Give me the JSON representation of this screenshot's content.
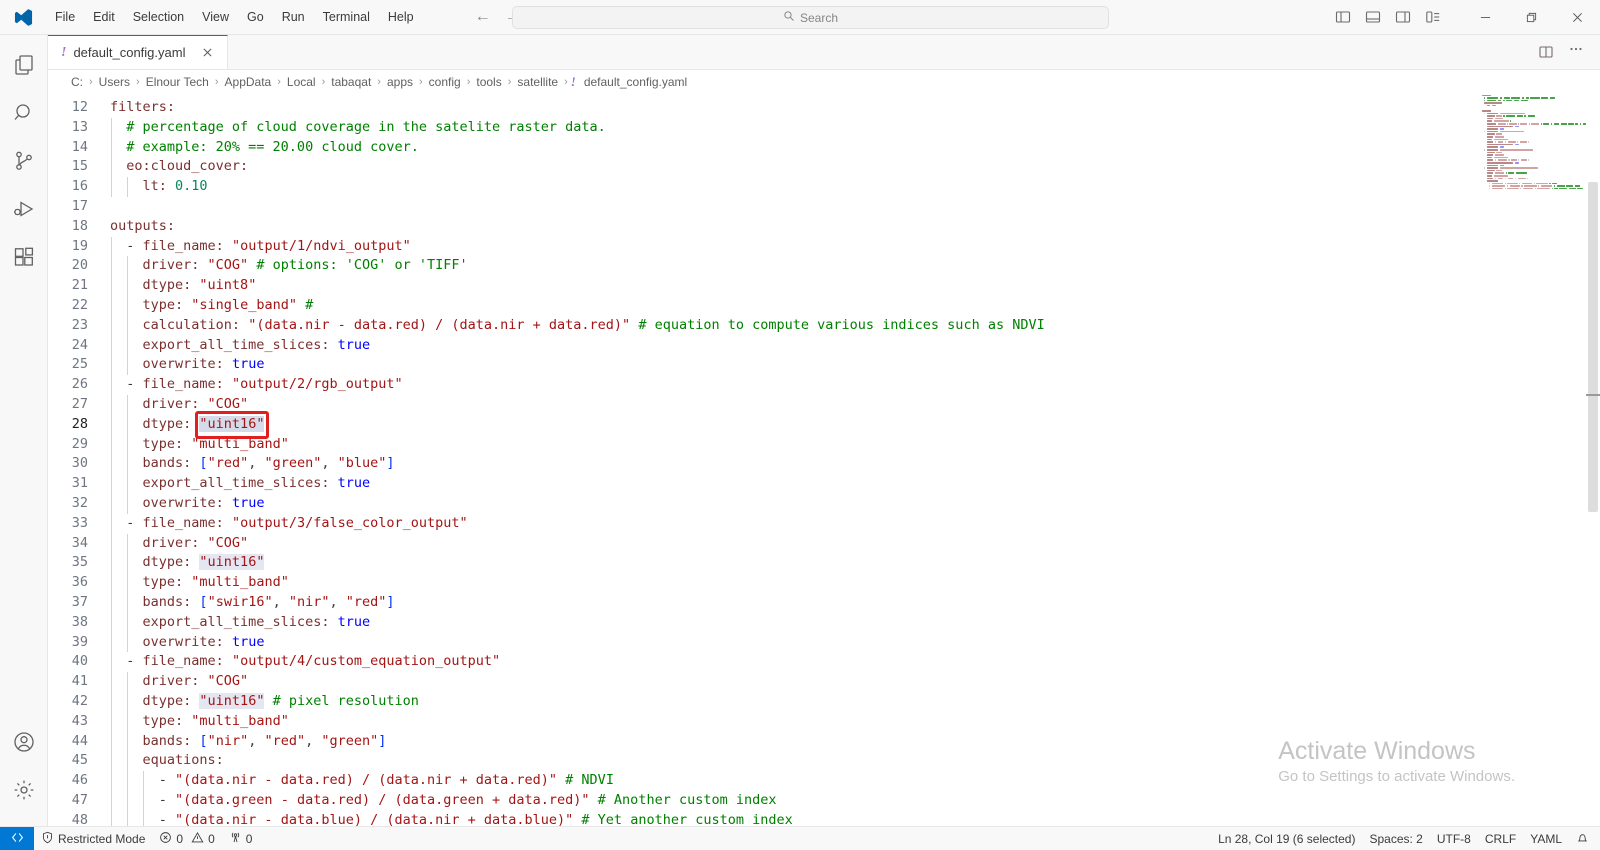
{
  "titlebar": {
    "logo_icon": "vscode-logo",
    "menus": [
      "File",
      "Edit",
      "Selection",
      "View",
      "Go",
      "Run",
      "Terminal",
      "Help"
    ],
    "nav_back_icon": "arrow-left-icon",
    "nav_forward_icon": "arrow-right-icon",
    "search": {
      "placeholder": "Search",
      "value": "",
      "icon": "search-icon"
    },
    "layout_buttons": [
      {
        "name": "toggle-primary-sidebar",
        "icon": "layout-sidebar-left-icon"
      },
      {
        "name": "toggle-panel",
        "icon": "layout-panel-icon"
      },
      {
        "name": "toggle-secondary-sidebar",
        "icon": "layout-sidebar-right-icon"
      },
      {
        "name": "customize-layout",
        "icon": "layout-customize-icon"
      }
    ],
    "window_controls": [
      {
        "name": "minimize",
        "icon": "minimize-icon"
      },
      {
        "name": "maximize",
        "icon": "restore-icon"
      },
      {
        "name": "close",
        "icon": "close-icon"
      }
    ]
  },
  "activitybar": {
    "top": [
      {
        "name": "explorer",
        "icon": "files-icon"
      },
      {
        "name": "search",
        "icon": "search-icon"
      },
      {
        "name": "source-control",
        "icon": "source-control-icon"
      },
      {
        "name": "run-and-debug",
        "icon": "run-debug-icon"
      },
      {
        "name": "extensions",
        "icon": "extensions-icon"
      }
    ],
    "bottom": [
      {
        "name": "accounts",
        "icon": "account-icon"
      },
      {
        "name": "manage",
        "icon": "gear-icon"
      }
    ]
  },
  "tabs": [
    {
      "label": "default_config.yaml",
      "icon": "yaml-file-icon",
      "close_icon": "close-icon",
      "active": true
    }
  ],
  "tabbar_actions": [
    {
      "name": "split-editor-right",
      "icon": "split-editor-icon"
    },
    {
      "name": "more-actions",
      "icon": "ellipsis-icon"
    }
  ],
  "breadcrumbs": {
    "separator": "›",
    "items": [
      "C:",
      "Users",
      "Elnour Tech",
      "AppData",
      "Local",
      "tabaqat",
      "apps",
      "config",
      "tools",
      "satellite"
    ],
    "file": {
      "label": "default_config.yaml",
      "icon": "yaml-file-icon"
    }
  },
  "editor": {
    "first_line_number": 12,
    "active_line": 28,
    "annotation": {
      "label": "highlight-box",
      "color": "#e02020",
      "target_text": "\"uint16\"",
      "line": 28
    },
    "lines": [
      {
        "n": 12,
        "indent_guides": 0,
        "tokens": [
          {
            "t": "filters:",
            "c": "t-key"
          }
        ]
      },
      {
        "n": 13,
        "indent_guides": 1,
        "tokens": [
          {
            "t": "  # percentage of cloud coverage in the satelite raster data.",
            "c": "t-cmt"
          }
        ]
      },
      {
        "n": 14,
        "indent_guides": 1,
        "tokens": [
          {
            "t": "  # example: 20% == 20.00 cloud cover.",
            "c": "t-cmt"
          }
        ]
      },
      {
        "n": 15,
        "indent_guides": 1,
        "tokens": [
          {
            "t": "  eo:cloud_cover:",
            "c": "t-key"
          }
        ]
      },
      {
        "n": 16,
        "indent_guides": 2,
        "tokens": [
          {
            "t": "    lt:",
            "c": "t-key"
          },
          {
            "t": " ",
            "c": "t-punct"
          },
          {
            "t": "0.10",
            "c": "t-num"
          }
        ]
      },
      {
        "n": 17,
        "indent_guides": 0,
        "tokens": []
      },
      {
        "n": 18,
        "indent_guides": 0,
        "tokens": [
          {
            "t": "outputs:",
            "c": "t-key"
          }
        ]
      },
      {
        "n": 19,
        "indent_guides": 1,
        "tokens": [
          {
            "t": "  - ",
            "c": "t-dash"
          },
          {
            "t": "file_name:",
            "c": "t-key"
          },
          {
            "t": " ",
            "c": "t-punct"
          },
          {
            "t": "\"output/1/ndvi_output\"",
            "c": "t-str"
          }
        ]
      },
      {
        "n": 20,
        "indent_guides": 2,
        "tokens": [
          {
            "t": "    driver:",
            "c": "t-key"
          },
          {
            "t": " ",
            "c": "t-punct"
          },
          {
            "t": "\"COG\"",
            "c": "t-str"
          },
          {
            "t": " # options: 'COG' or 'TIFF'",
            "c": "t-cmt"
          }
        ]
      },
      {
        "n": 21,
        "indent_guides": 2,
        "tokens": [
          {
            "t": "    dtype:",
            "c": "t-key"
          },
          {
            "t": " ",
            "c": "t-punct"
          },
          {
            "t": "\"uint8\"",
            "c": "t-str"
          }
        ]
      },
      {
        "n": 22,
        "indent_guides": 2,
        "tokens": [
          {
            "t": "    type:",
            "c": "t-key"
          },
          {
            "t": " ",
            "c": "t-punct"
          },
          {
            "t": "\"single_band\"",
            "c": "t-str"
          },
          {
            "t": " #",
            "c": "t-cmt"
          }
        ]
      },
      {
        "n": 23,
        "indent_guides": 2,
        "tokens": [
          {
            "t": "    calculation:",
            "c": "t-key"
          },
          {
            "t": " ",
            "c": "t-punct"
          },
          {
            "t": "\"(data.nir - data.red) / (data.nir + data.red)\"",
            "c": "t-str"
          },
          {
            "t": " # equation to compute various indices such as NDVI",
            "c": "t-cmt"
          }
        ]
      },
      {
        "n": 24,
        "indent_guides": 2,
        "tokens": [
          {
            "t": "    export_all_time_slices:",
            "c": "t-key"
          },
          {
            "t": " ",
            "c": "t-punct"
          },
          {
            "t": "true",
            "c": "t-bool"
          }
        ]
      },
      {
        "n": 25,
        "indent_guides": 2,
        "tokens": [
          {
            "t": "    overwrite:",
            "c": "t-key"
          },
          {
            "t": " ",
            "c": "t-punct"
          },
          {
            "t": "true",
            "c": "t-bool"
          }
        ]
      },
      {
        "n": 26,
        "indent_guides": 1,
        "tokens": [
          {
            "t": "  - ",
            "c": "t-dash"
          },
          {
            "t": "file_name:",
            "c": "t-key"
          },
          {
            "t": " ",
            "c": "t-punct"
          },
          {
            "t": "\"output/2/rgb_output\"",
            "c": "t-str"
          }
        ]
      },
      {
        "n": 27,
        "indent_guides": 2,
        "tokens": [
          {
            "t": "    driver:",
            "c": "t-key"
          },
          {
            "t": " ",
            "c": "t-punct"
          },
          {
            "t": "\"COG\"",
            "c": "t-str"
          }
        ]
      },
      {
        "n": 28,
        "indent_guides": 2,
        "tokens": [
          {
            "t": "    dtype:",
            "c": "t-key"
          },
          {
            "t": " ",
            "c": "t-punct"
          },
          {
            "t": "\"uint16\"",
            "c": "t-str sel-strong"
          }
        ]
      },
      {
        "n": 29,
        "indent_guides": 2,
        "tokens": [
          {
            "t": "    type:",
            "c": "t-key"
          },
          {
            "t": " ",
            "c": "t-punct"
          },
          {
            "t": "\"multi_band\"",
            "c": "t-str"
          }
        ]
      },
      {
        "n": 30,
        "indent_guides": 2,
        "tokens": [
          {
            "t": "    bands:",
            "c": "t-key"
          },
          {
            "t": " ",
            "c": "t-punct"
          },
          {
            "t": "[",
            "c": "t-brk"
          },
          {
            "t": "\"red\"",
            "c": "t-str"
          },
          {
            "t": ", ",
            "c": "t-punct"
          },
          {
            "t": "\"green\"",
            "c": "t-str"
          },
          {
            "t": ", ",
            "c": "t-punct"
          },
          {
            "t": "\"blue\"",
            "c": "t-str"
          },
          {
            "t": "]",
            "c": "t-brk"
          }
        ]
      },
      {
        "n": 31,
        "indent_guides": 2,
        "tokens": [
          {
            "t": "    export_all_time_slices:",
            "c": "t-key"
          },
          {
            "t": " ",
            "c": "t-punct"
          },
          {
            "t": "true",
            "c": "t-bool"
          }
        ]
      },
      {
        "n": 32,
        "indent_guides": 2,
        "tokens": [
          {
            "t": "    overwrite:",
            "c": "t-key"
          },
          {
            "t": " ",
            "c": "t-punct"
          },
          {
            "t": "true",
            "c": "t-bool"
          }
        ]
      },
      {
        "n": 33,
        "indent_guides": 1,
        "tokens": [
          {
            "t": "  - ",
            "c": "t-dash"
          },
          {
            "t": "file_name:",
            "c": "t-key"
          },
          {
            "t": " ",
            "c": "t-punct"
          },
          {
            "t": "\"output/3/false_color_output\"",
            "c": "t-str"
          }
        ]
      },
      {
        "n": 34,
        "indent_guides": 2,
        "tokens": [
          {
            "t": "    driver:",
            "c": "t-key"
          },
          {
            "t": " ",
            "c": "t-punct"
          },
          {
            "t": "\"COG\"",
            "c": "t-str"
          }
        ]
      },
      {
        "n": 35,
        "indent_guides": 2,
        "tokens": [
          {
            "t": "    dtype:",
            "c": "t-key"
          },
          {
            "t": " ",
            "c": "t-punct"
          },
          {
            "t": "\"uint16\"",
            "c": "t-str sel-hl"
          }
        ]
      },
      {
        "n": 36,
        "indent_guides": 2,
        "tokens": [
          {
            "t": "    type:",
            "c": "t-key"
          },
          {
            "t": " ",
            "c": "t-punct"
          },
          {
            "t": "\"multi_band\"",
            "c": "t-str"
          }
        ]
      },
      {
        "n": 37,
        "indent_guides": 2,
        "tokens": [
          {
            "t": "    bands:",
            "c": "t-key"
          },
          {
            "t": " ",
            "c": "t-punct"
          },
          {
            "t": "[",
            "c": "t-brk"
          },
          {
            "t": "\"swir16\"",
            "c": "t-str"
          },
          {
            "t": ", ",
            "c": "t-punct"
          },
          {
            "t": "\"nir\"",
            "c": "t-str"
          },
          {
            "t": ", ",
            "c": "t-punct"
          },
          {
            "t": "\"red\"",
            "c": "t-str"
          },
          {
            "t": "]",
            "c": "t-brk"
          }
        ]
      },
      {
        "n": 38,
        "indent_guides": 2,
        "tokens": [
          {
            "t": "    export_all_time_slices:",
            "c": "t-key"
          },
          {
            "t": " ",
            "c": "t-punct"
          },
          {
            "t": "true",
            "c": "t-bool"
          }
        ]
      },
      {
        "n": 39,
        "indent_guides": 2,
        "tokens": [
          {
            "t": "    overwrite:",
            "c": "t-key"
          },
          {
            "t": " ",
            "c": "t-punct"
          },
          {
            "t": "true",
            "c": "t-bool"
          }
        ]
      },
      {
        "n": 40,
        "indent_guides": 1,
        "tokens": [
          {
            "t": "  - ",
            "c": "t-dash"
          },
          {
            "t": "file_name:",
            "c": "t-key"
          },
          {
            "t": " ",
            "c": "t-punct"
          },
          {
            "t": "\"output/4/custom_equation_output\"",
            "c": "t-str"
          }
        ]
      },
      {
        "n": 41,
        "indent_guides": 2,
        "tokens": [
          {
            "t": "    driver:",
            "c": "t-key"
          },
          {
            "t": " ",
            "c": "t-punct"
          },
          {
            "t": "\"COG\"",
            "c": "t-str"
          }
        ]
      },
      {
        "n": 42,
        "indent_guides": 2,
        "tokens": [
          {
            "t": "    dtype:",
            "c": "t-key"
          },
          {
            "t": " ",
            "c": "t-punct"
          },
          {
            "t": "\"uint16\"",
            "c": "t-str sel-hl"
          },
          {
            "t": " # pixel resolution",
            "c": "t-cmt"
          }
        ]
      },
      {
        "n": 43,
        "indent_guides": 2,
        "tokens": [
          {
            "t": "    type:",
            "c": "t-key"
          },
          {
            "t": " ",
            "c": "t-punct"
          },
          {
            "t": "\"multi_band\"",
            "c": "t-str"
          }
        ]
      },
      {
        "n": 44,
        "indent_guides": 2,
        "tokens": [
          {
            "t": "    bands:",
            "c": "t-key"
          },
          {
            "t": " ",
            "c": "t-punct"
          },
          {
            "t": "[",
            "c": "t-brk"
          },
          {
            "t": "\"nir\"",
            "c": "t-str"
          },
          {
            "t": ", ",
            "c": "t-punct"
          },
          {
            "t": "\"red\"",
            "c": "t-str"
          },
          {
            "t": ", ",
            "c": "t-punct"
          },
          {
            "t": "\"green\"",
            "c": "t-str"
          },
          {
            "t": "]",
            "c": "t-brk"
          }
        ]
      },
      {
        "n": 45,
        "indent_guides": 2,
        "tokens": [
          {
            "t": "    equations:",
            "c": "t-key"
          }
        ]
      },
      {
        "n": 46,
        "indent_guides": 3,
        "tokens": [
          {
            "t": "      - ",
            "c": "t-dash"
          },
          {
            "t": "\"(data.nir - data.red) / (data.nir + data.red)\"",
            "c": "t-str"
          },
          {
            "t": " # NDVI",
            "c": "t-cmt"
          }
        ]
      },
      {
        "n": 47,
        "indent_guides": 3,
        "tokens": [
          {
            "t": "      - ",
            "c": "t-dash"
          },
          {
            "t": "\"(data.green - data.red) / (data.green + data.red)\"",
            "c": "t-str"
          },
          {
            "t": " # Another custom index",
            "c": "t-cmt"
          }
        ]
      },
      {
        "n": 48,
        "indent_guides": 3,
        "tokens": [
          {
            "t": "      - ",
            "c": "t-dash"
          },
          {
            "t": "\"(data.nir - data.blue) / (data.nir + data.blue)\"",
            "c": "t-str"
          },
          {
            "t": " # Yet another custom index",
            "c": "t-cmt"
          }
        ]
      }
    ]
  },
  "watermark": {
    "title": "Activate Windows",
    "subtitle": "Go to Settings to activate Windows."
  },
  "statusbar": {
    "remote_icon": "remote-window-icon",
    "left": [
      {
        "name": "restricted-mode",
        "icon": "shield-icon",
        "label": "Restricted Mode"
      },
      {
        "name": "problems",
        "icon": "error-warning-icon",
        "label": "0 ⚠ 0",
        "errors": "0",
        "warnings": "0"
      },
      {
        "name": "ports",
        "icon": "radio-tower-icon",
        "label": "0"
      }
    ],
    "right": [
      {
        "name": "editor-selection",
        "label": "Ln 28, Col 19 (6 selected)"
      },
      {
        "name": "indentation",
        "label": "Spaces: 2"
      },
      {
        "name": "encoding",
        "label": "UTF-8"
      },
      {
        "name": "eol",
        "label": "CRLF"
      },
      {
        "name": "language-mode",
        "label": "YAML"
      },
      {
        "name": "notifications",
        "icon": "bell-icon",
        "label": ""
      }
    ]
  },
  "colors": {
    "accent": "#0078d4",
    "annotation": "#e02020",
    "yaml_key": "#7b3030",
    "yaml_string": "#a31515",
    "yaml_comment": "#008000",
    "yaml_boolean": "#0000ff",
    "yaml_number": "#098658"
  }
}
